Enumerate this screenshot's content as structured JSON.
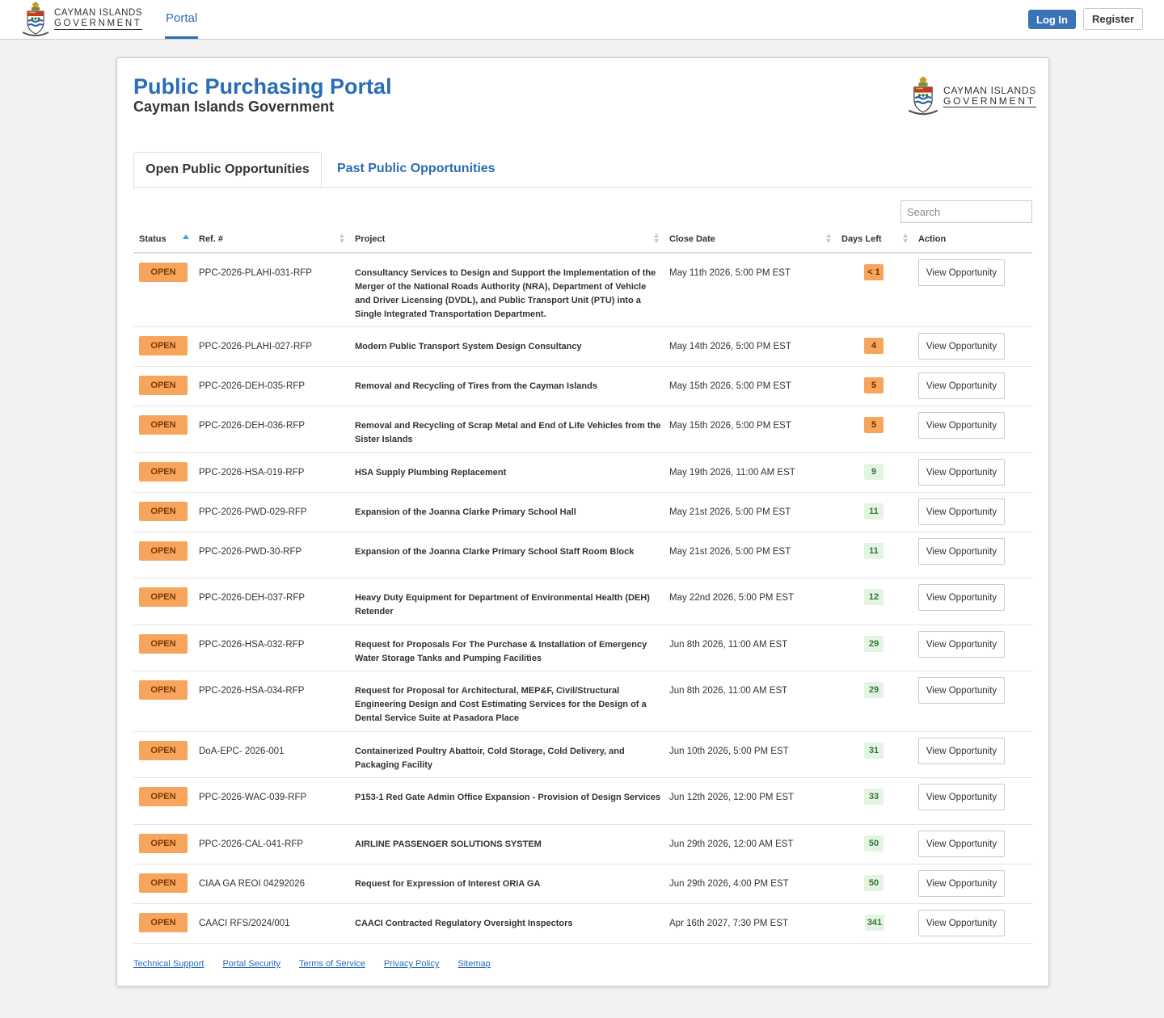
{
  "topnav": {
    "brand_line1": "CAYMAN ISLANDS",
    "brand_line2": "GOVERNMENT",
    "portal_link": "Portal",
    "login_label": "Log In",
    "register_label": "Register"
  },
  "header": {
    "title": "Public Purchasing Portal",
    "subtitle": "Cayman Islands Government",
    "brand_line1": "CAYMAN ISLANDS",
    "brand_line2": "GOVERNMENT"
  },
  "tabs": {
    "open_label": "Open Public Opportunities",
    "past_label": "Past Public Opportunities"
  },
  "search": {
    "placeholder": "Search"
  },
  "table": {
    "columns": {
      "status": "Status",
      "ref": "Ref. #",
      "project": "Project",
      "close_date": "Close Date",
      "days_left": "Days Left",
      "action": "Action"
    },
    "action_label": "View Opportunity",
    "rows": [
      {
        "status": "OPEN",
        "ref": "PPC-2026-PLAHI-031-RFP",
        "project": "Consultancy Services to Design and Support the Implementation of the Merger of the National Roads Authority (NRA), Department of Vehicle and Driver Licensing (DVDL), and Public Transport Unit (PTU) into a Single Integrated Transportation Department.",
        "close": "May 11th 2026, 5:00 PM EST",
        "days": "< 1",
        "tone": "warn"
      },
      {
        "status": "OPEN",
        "ref": "PPC-2026-PLAHI-027-RFP",
        "project": "Modern Public Transport System Design Consultancy",
        "close": "May 14th 2026, 5:00 PM EST",
        "days": "4",
        "tone": "warn"
      },
      {
        "status": "OPEN",
        "ref": "PPC-2026-DEH-035-RFP",
        "project": "Removal and Recycling of Tires from the Cayman Islands",
        "close": "May 15th 2026, 5:00 PM EST",
        "days": "5",
        "tone": "warn"
      },
      {
        "status": "OPEN",
        "ref": "PPC-2026-DEH-036-RFP",
        "project": "Removal and Recycling of Scrap Metal and End of Life Vehicles from the Sister Islands",
        "close": "May 15th 2026, 5:00 PM EST",
        "days": "5",
        "tone": "warn"
      },
      {
        "status": "OPEN",
        "ref": "PPC-2026-HSA-019-RFP",
        "project": "HSA Supply Plumbing Replacement",
        "close": "May 19th 2026, 11:00 AM EST",
        "days": "9",
        "tone": "ok"
      },
      {
        "status": "OPEN",
        "ref": "PPC-2026-PWD-029-RFP",
        "project": "Expansion of the Joanna Clarke Primary School Hall",
        "close": "May 21st 2026, 5:00 PM EST",
        "days": "11",
        "tone": "ok"
      },
      {
        "status": "OPEN",
        "ref": "PPC-2026-PWD-30-RFP",
        "project": "Expansion of the Joanna Clarke Primary School Staff Room Block",
        "close": "May 21st 2026, 5:00 PM EST",
        "days": "11",
        "tone": "ok"
      },
      {
        "status": "OPEN",
        "ref": "PPC-2026-DEH-037-RFP",
        "project": "Heavy Duty Equipment for Department of Environmental Health (DEH) Retender",
        "close": "May 22nd 2026, 5:00 PM EST",
        "days": "12",
        "tone": "ok"
      },
      {
        "status": "OPEN",
        "ref": "PPC-2026-HSA-032-RFP",
        "project": "Request for Proposals For The Purchase & Installation of Emergency Water Storage Tanks and Pumping Facilities",
        "close": "Jun 8th 2026, 11:00 AM EST",
        "days": "29",
        "tone": "ok"
      },
      {
        "status": "OPEN",
        "ref": "PPC-2026-HSA-034-RFP",
        "project": "Request for Proposal for Architectural, MEP&F, Civil/Structural Engineering Design and Cost Estimating Services for the Design of a Dental Service Suite at Pasadora Place",
        "close": "Jun 8th 2026, 11:00 AM EST",
        "days": "29",
        "tone": "ok"
      },
      {
        "status": "OPEN",
        "ref": "DoA-EPC- 2026-001",
        "project": "Containerized Poultry Abattoir, Cold Storage, Cold Delivery, and Packaging Facility",
        "close": "Jun 10th 2026, 5:00 PM EST",
        "days": "31",
        "tone": "ok"
      },
      {
        "status": "OPEN",
        "ref": "PPC-2026-WAC-039-RFP",
        "project": "P153-1 Red Gate Admin Office Expansion - Provision of Design Services",
        "close": "Jun 12th 2026, 12:00 PM EST",
        "days": "33",
        "tone": "ok"
      },
      {
        "status": "OPEN",
        "ref": "PPC-2026-CAL-041-RFP",
        "project": "AIRLINE PASSENGER SOLUTIONS SYSTEM",
        "close": "Jun 29th 2026, 12:00 AM EST",
        "days": "50",
        "tone": "ok"
      },
      {
        "status": "OPEN",
        "ref": "CIAA GA REOI 04292026",
        "project": "Request for Expression of Interest ORIA GA",
        "close": "Jun 29th 2026, 4:00 PM EST",
        "days": "50",
        "tone": "ok"
      },
      {
        "status": "OPEN",
        "ref": "CAACI RFS/2024/001",
        "project": "CAACI Contracted Regulatory Oversight Inspectors",
        "close": "Apr 16th 2027, 7:30 PM EST",
        "days": "341",
        "tone": "ok"
      }
    ]
  },
  "footer": {
    "links": [
      "Technical Support",
      "Portal Security",
      "Terms of Service",
      "Privacy Policy",
      "Sitemap"
    ]
  }
}
